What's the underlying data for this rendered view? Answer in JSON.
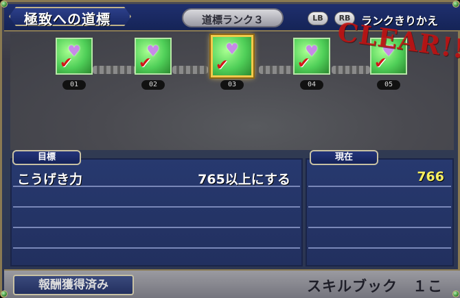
{
  "header": {
    "title": "極致への道標",
    "rank_label": "道標ランク３",
    "lb_label": "LB",
    "rb_label": "RB",
    "switch_label": "ランクきりかえ"
  },
  "ranks": [
    {
      "num": "01",
      "cleared": true,
      "active": false
    },
    {
      "num": "02",
      "cleared": true,
      "active": false
    },
    {
      "num": "03",
      "cleared": true,
      "active": true
    },
    {
      "num": "04",
      "cleared": true,
      "active": false
    },
    {
      "num": "05",
      "cleared": true,
      "active": false
    }
  ],
  "clear_stamp": "CLEAR!!",
  "goal_panel": {
    "label": "目標",
    "stat": "こうげき力",
    "condition": "765以上にする"
  },
  "current_panel": {
    "label": "現在",
    "value": "766"
  },
  "footer": {
    "status": "報酬獲得済み",
    "reward": "スキルブック　１こ"
  },
  "colors": {
    "header_bg": "#1f2f6e",
    "current_value": "#f7ef60",
    "clear_stamp": "#c81414",
    "active_border": "#f2c94c"
  },
  "icons": {
    "emblem": "heart-gift-emblem-icon",
    "check": "check-mark-icon"
  }
}
